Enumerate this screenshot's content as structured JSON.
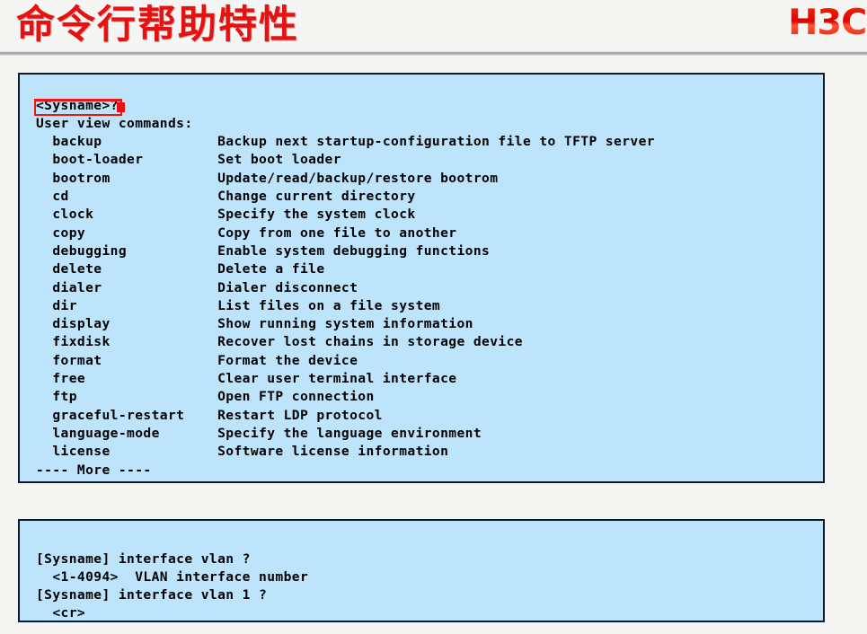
{
  "header": {
    "title": "命令行帮助特性",
    "logo_text": "H3C",
    "logo_color": "#f01c08",
    "title_color": "#e8110f"
  },
  "annotation": {
    "name": "user-view-highlight",
    "color": "#f01414",
    "target_text": "User view"
  },
  "terminals": [
    {
      "id": "user-view-help-output",
      "background": "#bde4fb",
      "border_color": "#0a1a33",
      "prompt_line": "<Sysname>?",
      "section_header": "User view commands:",
      "commands": [
        {
          "name": "backup",
          "description": "Backup next startup-configuration file to TFTP server"
        },
        {
          "name": "boot-loader",
          "description": "Set boot loader"
        },
        {
          "name": "bootrom",
          "description": "Update/read/backup/restore bootrom"
        },
        {
          "name": "cd",
          "description": "Change current directory"
        },
        {
          "name": "clock",
          "description": "Specify the system clock"
        },
        {
          "name": "copy",
          "description": "Copy from one file to another"
        },
        {
          "name": "debugging",
          "description": "Enable system debugging functions"
        },
        {
          "name": "delete",
          "description": "Delete a file"
        },
        {
          "name": "dialer",
          "description": "Dialer disconnect"
        },
        {
          "name": "dir",
          "description": "List files on a file system"
        },
        {
          "name": "display",
          "description": "Show running system information"
        },
        {
          "name": "fixdisk",
          "description": "Recover lost chains in storage device"
        },
        {
          "name": "format",
          "description": "Format the device"
        },
        {
          "name": "free",
          "description": "Clear user terminal interface"
        },
        {
          "name": "ftp",
          "description": "Open FTP connection"
        },
        {
          "name": "graceful-restart",
          "description": "Restart LDP protocol"
        },
        {
          "name": "language-mode",
          "description": "Specify the language environment"
        },
        {
          "name": "license",
          "description": "Software license information"
        }
      ],
      "more_indicator": "---- More ----"
    },
    {
      "id": "interface-vlan-help-output",
      "background": "#bde4fb",
      "border_color": "#0a1a33",
      "lines": [
        "[Sysname] interface vlan ?",
        "  <1-4094>  VLAN interface number",
        "[Sysname] interface vlan 1 ?",
        "  <cr>"
      ]
    }
  ]
}
